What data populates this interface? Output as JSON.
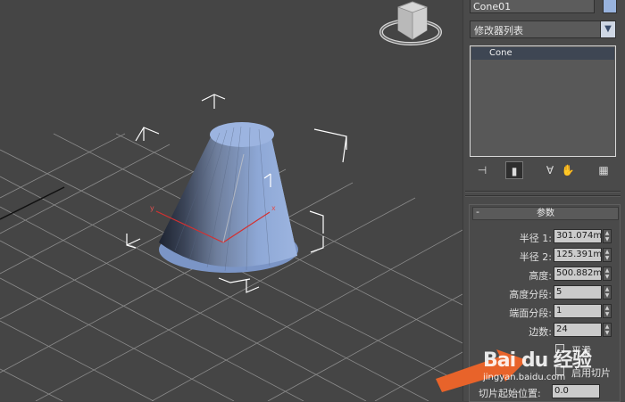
{
  "command_panel": {
    "object_name": "Cone01",
    "object_color": "#98b3de",
    "modifier_list_label": "修改器列表",
    "modifier_stack": [
      "Cone"
    ],
    "toolbar_icons": [
      "pin-stack-icon",
      "show-end-result-icon",
      "make-unique-icon",
      "remove-modifier-icon",
      "configure-modifier-sets-icon"
    ]
  },
  "parameters": {
    "rollout_title": "参数",
    "collapse_symbol": "-",
    "fields": [
      {
        "label": "半径 1:",
        "value": "301.074m"
      },
      {
        "label": "半径 2:",
        "value": "125.391m"
      },
      {
        "label": "高度:",
        "value": "500.882m"
      },
      {
        "label": "高度分段:",
        "value": "5"
      },
      {
        "label": "端面分段:",
        "value": "1"
      },
      {
        "label": "边数:",
        "value": "24"
      }
    ],
    "smooth_label": "平滑",
    "slice_on_label": "启用切片",
    "slice_from_label": "切片起始位置:",
    "slice_from_value": "0.0"
  },
  "viewport": {
    "object_color": "#8aa6d8",
    "grid_color": "#8a8a8a",
    "axis_labels": {
      "x": "x",
      "y": "y"
    }
  },
  "watermark": {
    "brand": "Bai du 经验",
    "url": "jingyan.baidu.com"
  }
}
